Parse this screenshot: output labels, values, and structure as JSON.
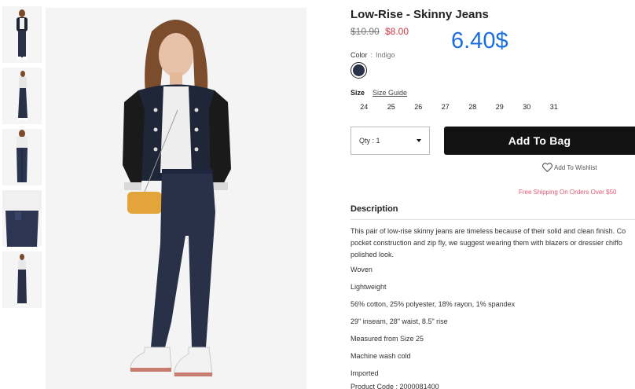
{
  "product": {
    "title": "Low-Rise - Skinny Jeans",
    "price_old": "$10.90",
    "price_new": "$8.00",
    "price_overlay": "6.40$",
    "color_label": "Color",
    "color_separator": ":",
    "color_value": "Indigo",
    "swatch_color": "#283148",
    "size_label": "Size",
    "size_guide": "Size Guide",
    "sizes": [
      "24",
      "25",
      "26",
      "27",
      "28",
      "29",
      "30",
      "31"
    ],
    "qty_label": "Qty : 1",
    "add_to_bag": "Add To Bag",
    "wishlist": "Add To Wishlist",
    "free_shipping": "Free Shipping On Orders Over $50"
  },
  "description": {
    "heading": "Description",
    "paragraph_lines": [
      "This pair of low-rise skinny jeans are timeless because of their solid and clean finish. Co",
      "pocket construction and zip fly, we suggest wearing them with blazers or dressier chiffo",
      "polished look."
    ],
    "bullets": [
      "Woven",
      "Lightweight",
      "56% cotton, 25% polyester, 18% rayon, 1% spandex",
      "29\" inseam, 28\" waist, 8.5\" rise",
      "Measured from Size 25",
      "Machine wash cold",
      "Imported",
      "Product Code : 2000081400"
    ]
  },
  "colors": {
    "accent_blue": "#1a6fe0",
    "sale_red": "#d2383f",
    "shipping_pink": "#e0567a",
    "button_black": "#121212"
  }
}
